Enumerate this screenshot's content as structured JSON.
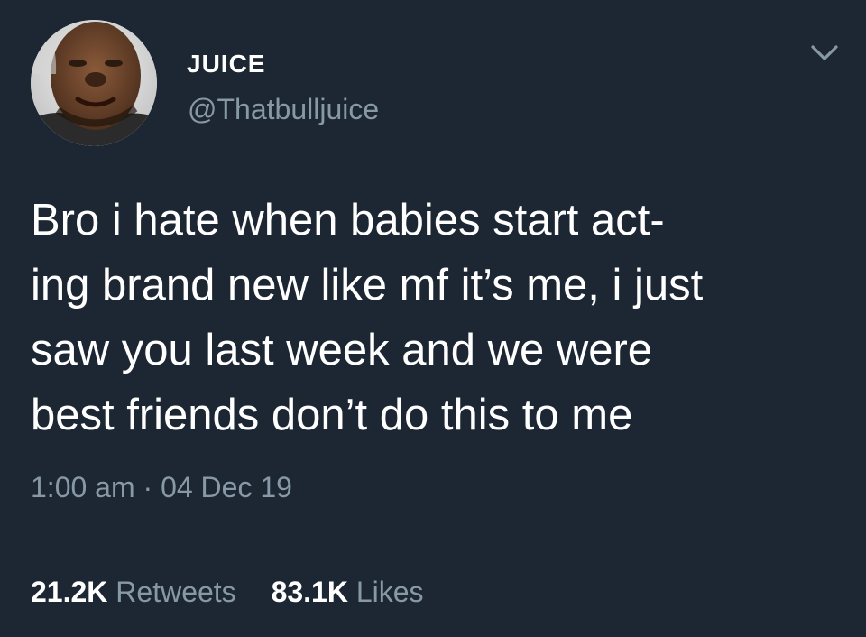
{
  "author": {
    "name": "JUICE",
    "handle": "@Thatbulljuice",
    "avatar_icon": "profile-photo"
  },
  "menu_icon": "chevron-down-icon",
  "tweet": {
    "lines": [
      "Bro i hate when babies start act-",
      "ing brand new like mf it’s me, i just",
      "saw you last week and we were",
      "best friends don’t do this to me"
    ]
  },
  "meta": {
    "time": "1:00 am",
    "separator": "·",
    "date": "04 Dec 19"
  },
  "stats": {
    "retweets_count": "21.2K",
    "retweets_label": "Retweets",
    "likes_count": "83.1K",
    "likes_label": "Likes"
  },
  "colors": {
    "background": "#1c2733",
    "primary_text": "#ffffff",
    "secondary_text": "#8899a6",
    "divider": "#38444d"
  }
}
